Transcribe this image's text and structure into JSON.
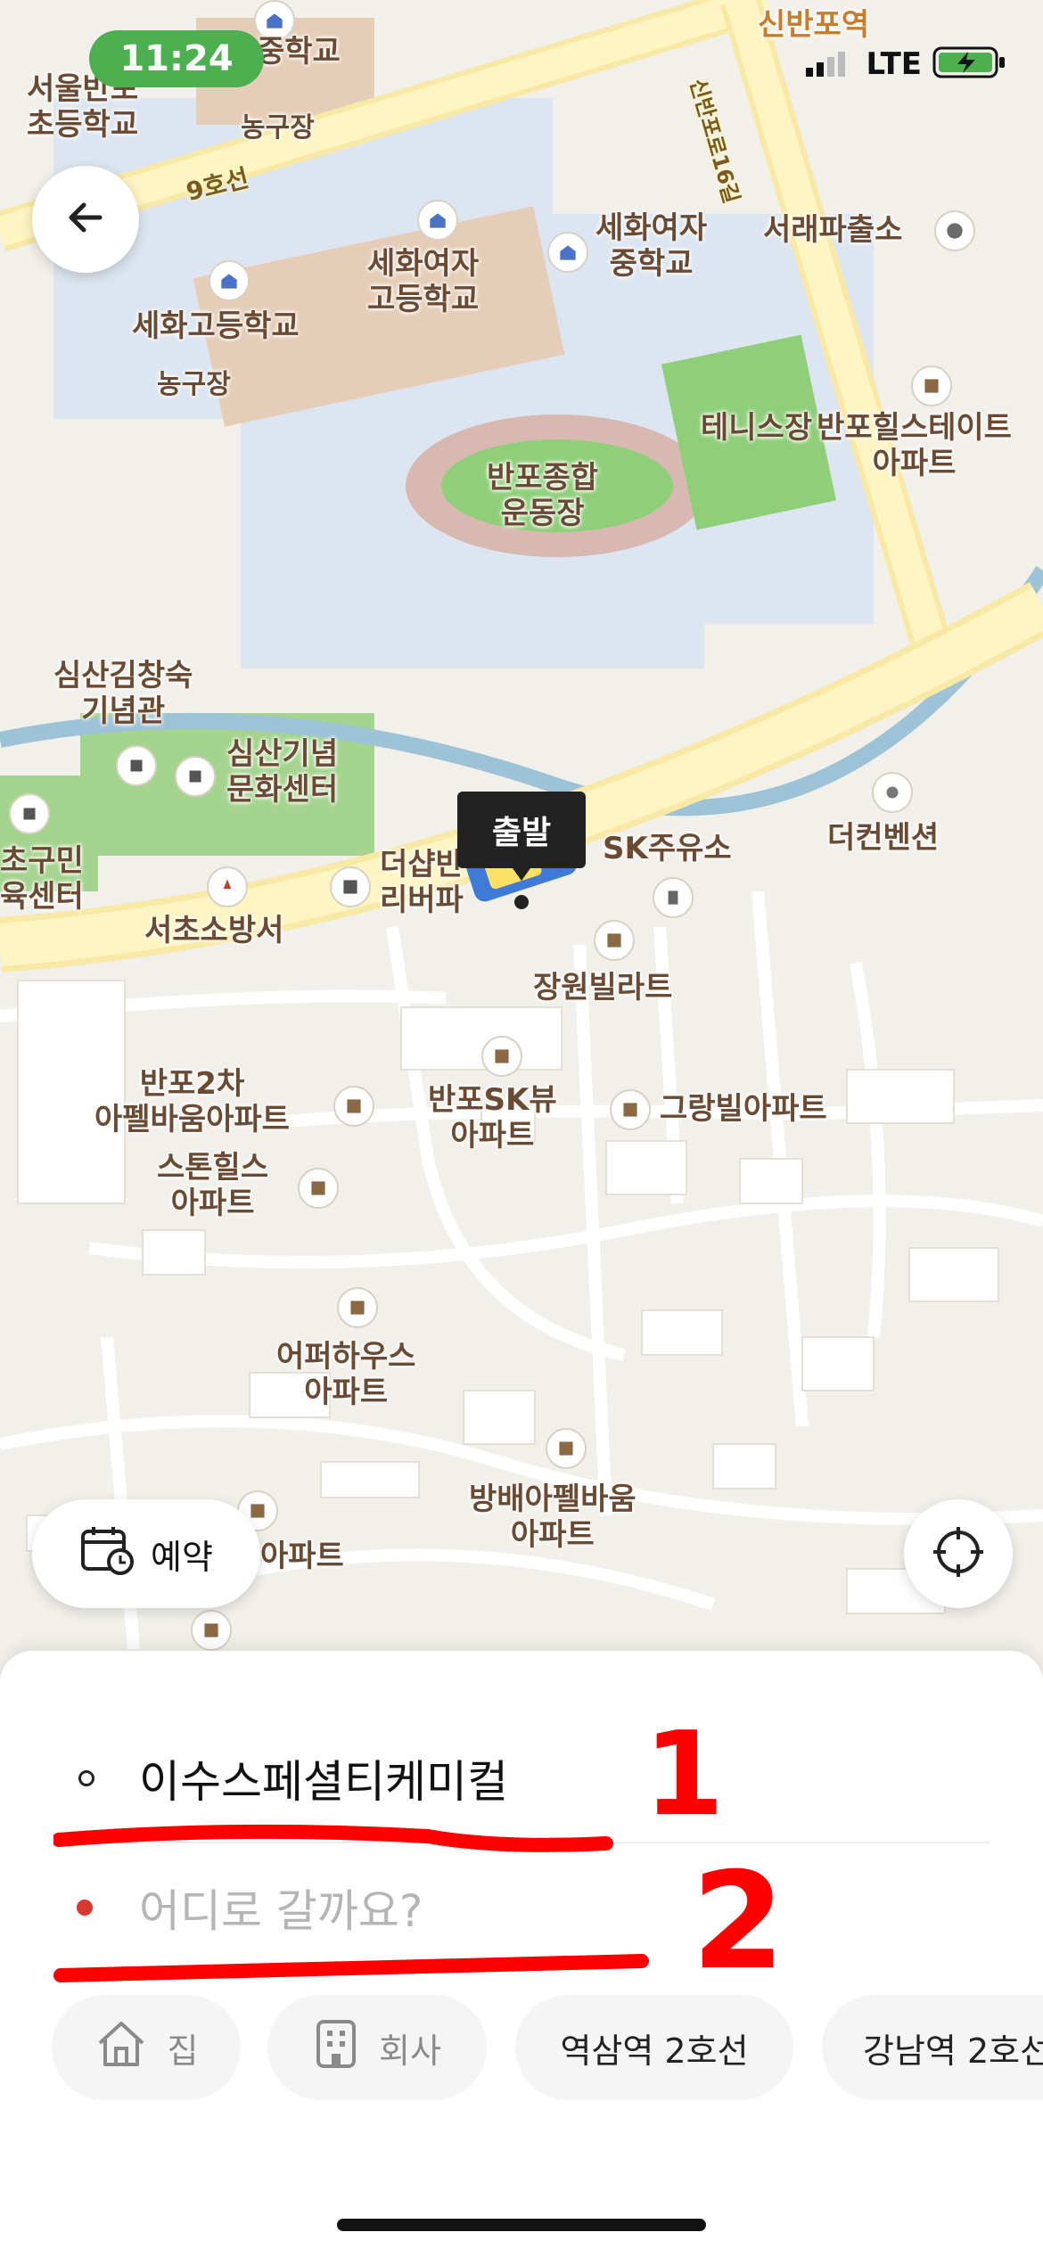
{
  "status_bar": {
    "time": "11:24",
    "network": "LTE"
  },
  "map": {
    "areas": [
      {
        "id": "school1",
        "text": "서울반포\n초등학교"
      },
      {
        "id": "school2",
        "text": "중학교"
      },
      {
        "id": "court1",
        "text": "농구장"
      },
      {
        "id": "line9",
        "text": "9호선"
      },
      {
        "id": "girls-hs",
        "text": "세화여자\n고등학교"
      },
      {
        "id": "girls-ms",
        "text": "세화여자\n중학교"
      },
      {
        "id": "boys-hs",
        "text": "세화고등학교"
      },
      {
        "id": "court2",
        "text": "농구장"
      },
      {
        "id": "stadium",
        "text": "반포종합\n운동장"
      },
      {
        "id": "tennis",
        "text": "테니스장"
      },
      {
        "id": "hills",
        "text": "반포힐스테이트\n아파트"
      },
      {
        "id": "police",
        "text": "서래파출소"
      },
      {
        "id": "station-sinbanpo",
        "text": "신반포역"
      },
      {
        "id": "memorial",
        "text": "심산김창숙\n기념관"
      },
      {
        "id": "culture",
        "text": "심산기념\n문화센터"
      },
      {
        "id": "sports-center",
        "text": "초구민\n육센터"
      },
      {
        "id": "fire",
        "text": "서초소방서"
      },
      {
        "id": "theshop",
        "text": "더샵반\n리버파"
      },
      {
        "id": "sk-gas",
        "text": "SK주유소"
      },
      {
        "id": "convention",
        "text": "더컨벤션"
      },
      {
        "id": "jangwon",
        "text": "장원빌라트"
      },
      {
        "id": "banpo2",
        "text": "반포2차\n아펠바움아파트"
      },
      {
        "id": "stonehills",
        "text": "스톤힐스\n아파트"
      },
      {
        "id": "banposk",
        "text": "반포SK뷰\n아파트"
      },
      {
        "id": "grangvil",
        "text": "그랑빌아파트"
      },
      {
        "id": "upperhouse",
        "text": "어퍼하우스\n아파트"
      },
      {
        "id": "bangbae",
        "text": "방배아펠바움\n아파트"
      },
      {
        "id": "apt",
        "text": "아파트"
      }
    ],
    "road_label_vertical": "신반포로16길",
    "departure_tag": "출발"
  },
  "buttons": {
    "back_icon": "arrow-left-icon",
    "reserve_label": "예약",
    "locate_icon": "crosshair-icon"
  },
  "route": {
    "origin": "이수스페셜티케미컬",
    "destination_placeholder": "어디로 갈까요?"
  },
  "shortcuts": [
    {
      "label": "집",
      "icon": "home-icon"
    },
    {
      "label": "회사",
      "icon": "building-icon"
    },
    {
      "label": "역삼역 2호선"
    },
    {
      "label": "강남역 2호선"
    }
  ],
  "annotations": {
    "mark1": "1",
    "mark2": "2"
  },
  "colors": {
    "status_pill": "#4caf50",
    "dest_dot": "#d9382e",
    "annotation_red": "#ff0000"
  }
}
